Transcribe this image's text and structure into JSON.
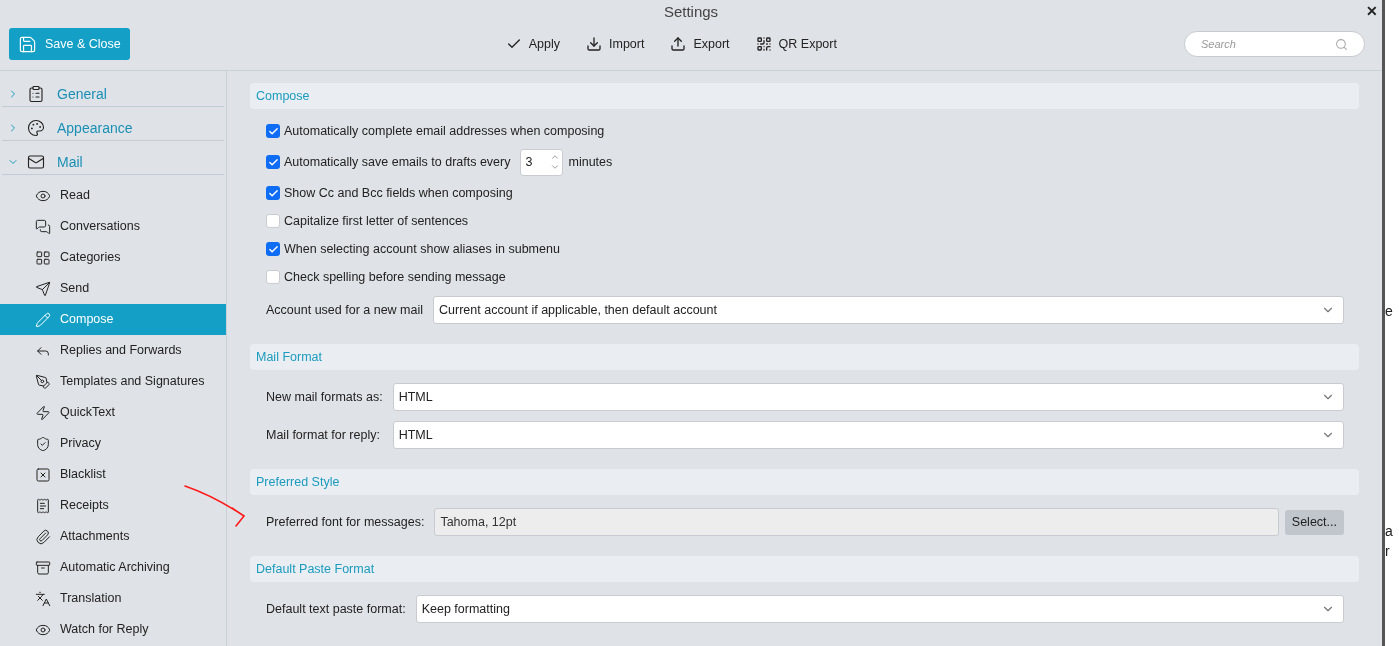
{
  "window": {
    "title": "Settings",
    "close": "✕"
  },
  "save_button": {
    "label": "Save & Close"
  },
  "toolbar": [
    {
      "kind": "apply",
      "label": "Apply"
    },
    {
      "kind": "import",
      "label": "Import"
    },
    {
      "kind": "export",
      "label": "Export"
    },
    {
      "kind": "qr",
      "label": "QR Export"
    }
  ],
  "search": {
    "placeholder": "Search"
  },
  "sidebar": {
    "groups": [
      {
        "label": "General",
        "expanded": false
      },
      {
        "label": "Appearance",
        "expanded": false
      },
      {
        "label": "Mail",
        "expanded": true,
        "children": [
          {
            "label": "Read",
            "selected": false
          },
          {
            "label": "Conversations",
            "selected": false
          },
          {
            "label": "Categories",
            "selected": false
          },
          {
            "label": "Send",
            "selected": false
          },
          {
            "label": "Compose",
            "selected": true
          },
          {
            "label": "Replies and Forwards",
            "selected": false
          },
          {
            "label": "Templates and Signatures",
            "selected": false
          },
          {
            "label": "QuickText",
            "selected": false
          },
          {
            "label": "Privacy",
            "selected": false
          },
          {
            "label": "Blacklist",
            "selected": false
          },
          {
            "label": "Receipts",
            "selected": false
          },
          {
            "label": "Attachments",
            "selected": false
          },
          {
            "label": "Automatic Archiving",
            "selected": false
          },
          {
            "label": "Translation",
            "selected": false
          },
          {
            "label": "Watch for Reply",
            "selected": false
          }
        ]
      }
    ]
  },
  "sections": [
    {
      "title": "Compose",
      "rows": [
        {
          "kind": "checkbox",
          "label": "Automatically complete email addresses when composing",
          "checked": true
        },
        {
          "kind": "checkbox_spin",
          "label": "Automatically save emails to drafts every",
          "value": "3",
          "suffix": "minutes",
          "checked": true
        },
        {
          "kind": "checkbox",
          "label": "Show Cc and Bcc fields when composing",
          "checked": true
        },
        {
          "kind": "checkbox",
          "label": "Capitalize first letter of sentences",
          "checked": false
        },
        {
          "kind": "checkbox",
          "label": "When selecting account show aliases in submenu",
          "checked": true
        },
        {
          "kind": "checkbox",
          "label": "Check spelling before sending message",
          "checked": false
        },
        {
          "kind": "select",
          "label": "Account used for a new mail",
          "value": "Current account if applicable, then default account"
        }
      ]
    },
    {
      "title": "Mail Format",
      "rows": [
        {
          "kind": "select",
          "label": "New mail formats as:",
          "value": "HTML"
        },
        {
          "kind": "select",
          "label": "Mail format for reply:",
          "value": "HTML"
        }
      ]
    },
    {
      "title": "Preferred Style",
      "rows": [
        {
          "kind": "font",
          "label": "Preferred font for messages:",
          "value": "Tahoma, 12pt",
          "button": "Select..."
        }
      ]
    },
    {
      "title": "Default Paste Format",
      "rows": [
        {
          "kind": "select",
          "label": "Default text paste format:",
          "value": "Keep formatting"
        }
      ]
    }
  ],
  "background_window": {
    "fragments": [
      "e",
      "a",
      "r"
    ]
  }
}
